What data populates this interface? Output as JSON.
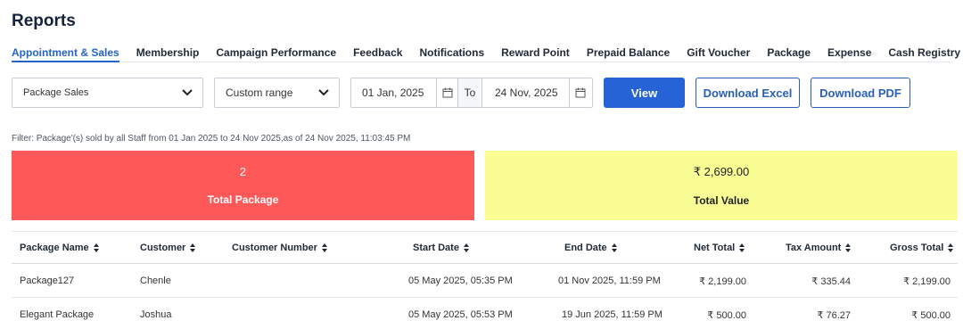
{
  "page": {
    "title": "Reports"
  },
  "tabs": [
    {
      "label": "Appointment & Sales"
    },
    {
      "label": "Membership"
    },
    {
      "label": "Campaign Performance"
    },
    {
      "label": "Feedback"
    },
    {
      "label": "Notifications"
    },
    {
      "label": "Reward Point"
    },
    {
      "label": "Prepaid Balance"
    },
    {
      "label": "Gift Voucher"
    },
    {
      "label": "Package"
    },
    {
      "label": "Expense"
    },
    {
      "label": "Cash Registry"
    }
  ],
  "filters": {
    "report_type": "Package Sales",
    "range": "Custom range",
    "from_date": "01 Jan, 2025",
    "to_label": "To",
    "to_date": "24 Nov, 2025"
  },
  "buttons": {
    "view": "View",
    "excel": "Download Excel",
    "pdf": "Download PDF"
  },
  "filter_text": "Filter: Package'(s) sold by all Staff from 01 Jan 2025 to 24 Nov 2025,as of 24 Nov 2025, 11:03:45 PM",
  "summary": {
    "total_package_value": "2",
    "total_package_label": "Total Package",
    "total_value_value": "₹ 2,699.00",
    "total_value_label": "Total Value"
  },
  "table": {
    "headers": {
      "package_name": "Package Name",
      "customer": "Customer",
      "customer_number": "Customer Number",
      "start_date": "Start Date",
      "end_date": "End Date",
      "net_total": "Net Total",
      "tax_amount": "Tax Amount",
      "gross_total": "Gross Total"
    },
    "rows": [
      {
        "package_name": "Package127",
        "customer": "Chenle",
        "customer_number": "",
        "start_date": "05 May 2025, 05:35 PM",
        "end_date": "01 Nov 2025, 11:59 PM",
        "net_total": "₹ 2,199.00",
        "tax_amount": "₹ 335.44",
        "gross_total": "₹ 2,199.00"
      },
      {
        "package_name": "Elegant Package",
        "customer": "Joshua",
        "customer_number": "",
        "start_date": "05 May 2025, 05:53 PM",
        "end_date": "19 Jun 2025, 11:59 PM",
        "net_total": "₹ 500.00",
        "tax_amount": "₹ 76.27",
        "gross_total": "₹ 500.00"
      }
    ]
  },
  "colors": {
    "accent": "#2563d6",
    "card_red": "#ff5858",
    "card_yellow": "#fafc94"
  },
  "icons": {
    "dropdown": "chevron-down-icon",
    "calendar": "calendar-icon",
    "sort": "sort-icon"
  }
}
